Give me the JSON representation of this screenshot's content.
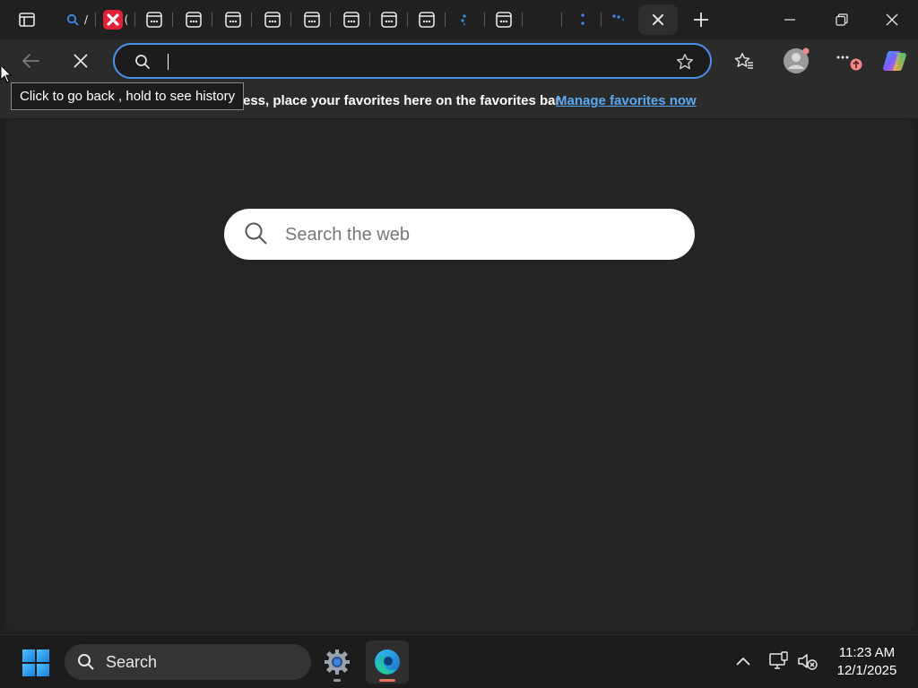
{
  "tabs": {
    "items": [
      {
        "icon": "search-icon"
      },
      {
        "icon": "red-x-app-icon"
      },
      {
        "icon": "page-icon"
      },
      {
        "icon": "page-icon"
      },
      {
        "icon": "page-icon"
      },
      {
        "icon": "page-icon"
      },
      {
        "icon": "page-icon"
      },
      {
        "icon": "page-icon"
      },
      {
        "icon": "page-icon"
      },
      {
        "icon": "page-icon"
      },
      {
        "icon": "loading-icon"
      },
      {
        "icon": "page-icon"
      },
      {
        "icon": "blank-icon"
      },
      {
        "icon": "loading-icon"
      },
      {
        "icon": "loading-icon"
      }
    ],
    "active_index": 15
  },
  "tooltip": {
    "text": "Click to go back , hold to see history"
  },
  "address": {
    "value": ""
  },
  "favorites_bar": {
    "text": "ess, place your favorites here on the favorites bar.",
    "link": "Manage favorites now"
  },
  "content": {
    "search_placeholder": "Search the web"
  },
  "taskbar": {
    "search_label": "Search",
    "time": "11:23 AM",
    "date": "12/1/2025"
  },
  "colors": {
    "accent": "#4a8fe8",
    "link": "#5aa8f0",
    "edge_indicator": "#e8735a",
    "settings_indicator": "#9a9a9a"
  }
}
